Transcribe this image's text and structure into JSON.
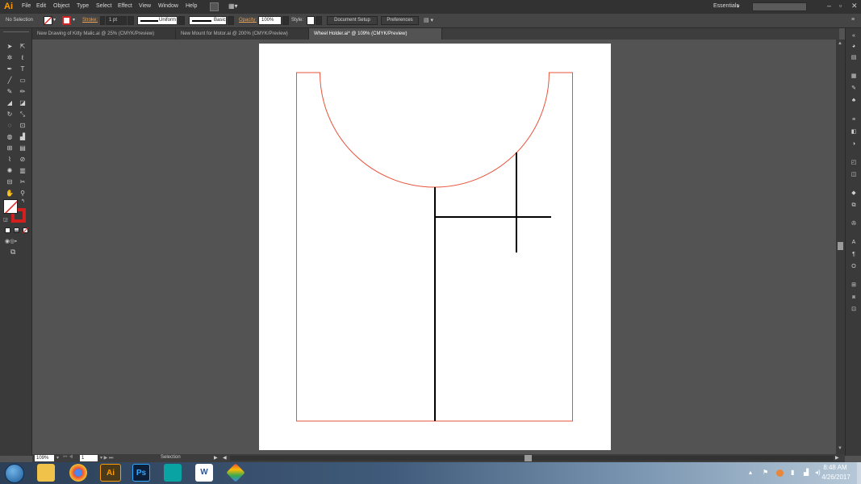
{
  "app": {
    "logo": "Ai",
    "workspace": "Essentials"
  },
  "menu": [
    "File",
    "Edit",
    "Object",
    "Type",
    "Select",
    "Effect",
    "View",
    "Window",
    "Help"
  ],
  "control": {
    "selection": "No Selection",
    "stroke_label": "Stroke:",
    "stroke_value": "1 pt",
    "profile": "Uniform",
    "brush": "Basic",
    "opacity_label": "Opacity:",
    "opacity_value": "100%",
    "style_label": "Style:",
    "doc_setup": "Document Setup",
    "preferences": "Preferences"
  },
  "tabs": [
    {
      "label": "New Drawing of Kitty Malic.ai @ 25% (CMYK/Preview)",
      "active": false
    },
    {
      "label": "New Mount for Motor.ai @ 200% (CMYK/Preview)",
      "active": false
    },
    {
      "label": "Wheel Holder.ai* @ 109% (CMYK/Preview)",
      "active": true
    }
  ],
  "status": {
    "zoom": "109%",
    "page": "1",
    "tool": "Selection"
  },
  "taskbar": {
    "apps": [
      "Explorer",
      "Chrome",
      "Ai",
      "Ps",
      "Maya",
      "W",
      "Maps"
    ],
    "time": "8:48 AM",
    "date": "4/26/2017"
  },
  "colors": {
    "accent": "#ff9a00",
    "artboard_outline": "#e8533a",
    "stroke": "#000000"
  }
}
